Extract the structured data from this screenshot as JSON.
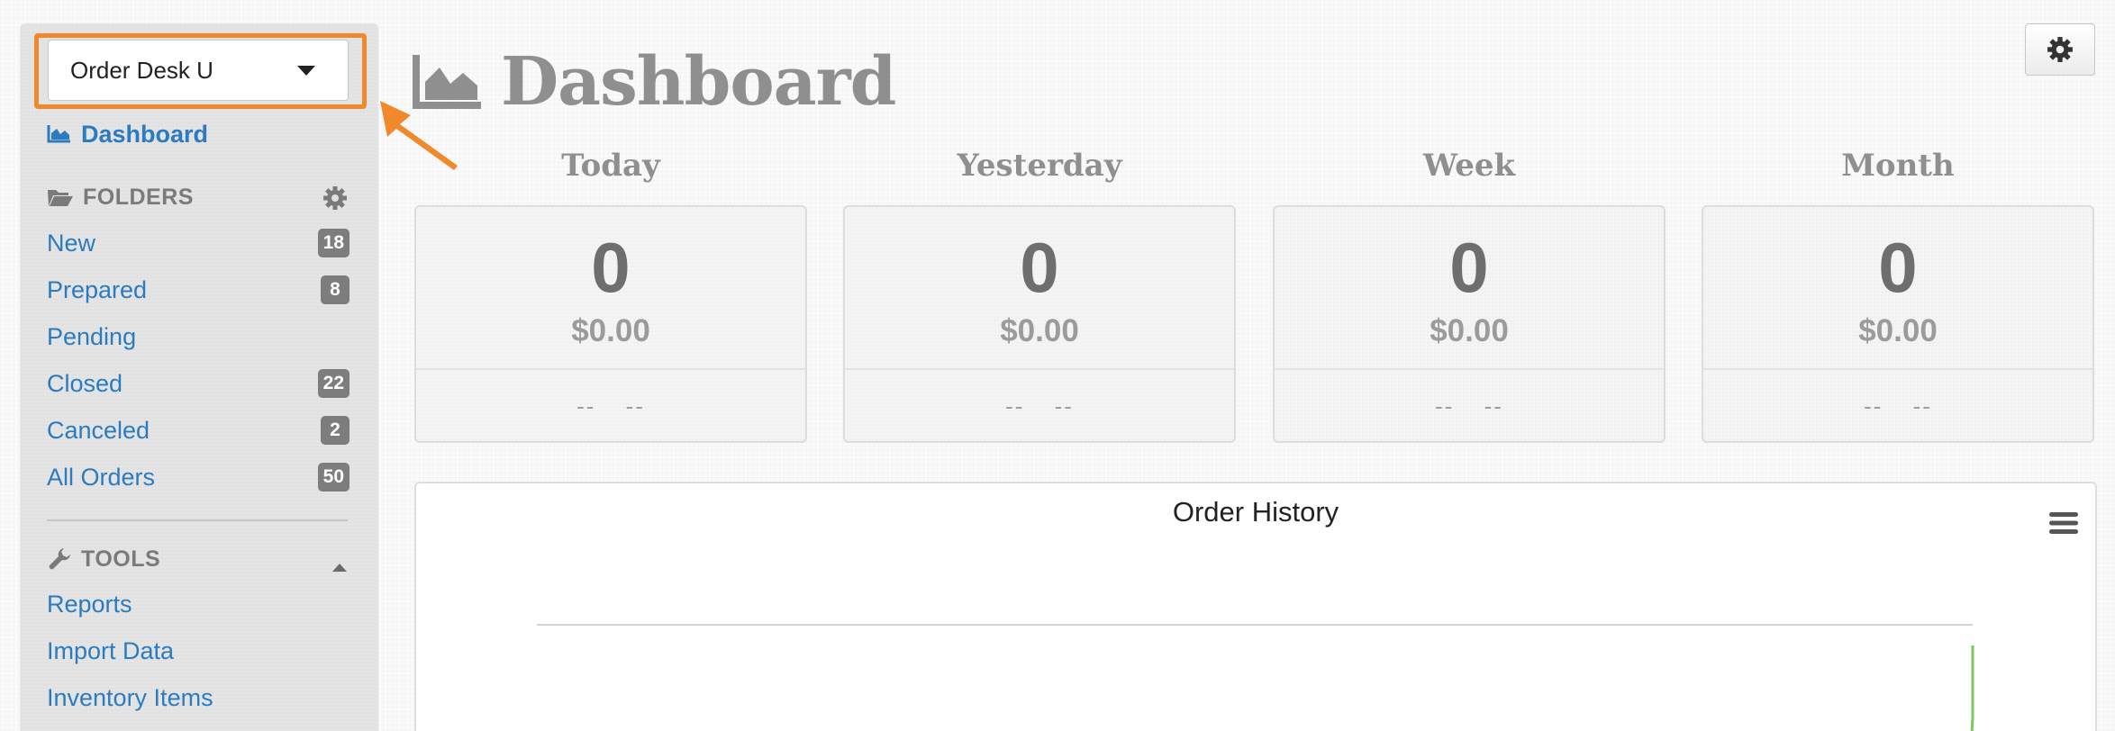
{
  "sidebar": {
    "store_selector": {
      "value": "Order Desk U"
    },
    "dashboard_link": "Dashboard",
    "folders": {
      "heading": "FOLDERS",
      "items": [
        {
          "label": "New",
          "count": "18"
        },
        {
          "label": "Prepared",
          "count": "8"
        },
        {
          "label": "Pending",
          "count": null
        },
        {
          "label": "Closed",
          "count": "22"
        },
        {
          "label": "Canceled",
          "count": "2"
        },
        {
          "label": "All Orders",
          "count": "50"
        }
      ]
    },
    "tools": {
      "heading": "TOOLS",
      "items": [
        {
          "label": "Reports"
        },
        {
          "label": "Import Data"
        },
        {
          "label": "Inventory Items"
        }
      ]
    }
  },
  "header": {
    "title": "Dashboard"
  },
  "stats": [
    {
      "label": "Today",
      "count": "0",
      "amount": "$0.00",
      "footer": "-- --"
    },
    {
      "label": "Yesterday",
      "count": "0",
      "amount": "$0.00",
      "footer": "-- --"
    },
    {
      "label": "Week",
      "count": "0",
      "amount": "$0.00",
      "footer": "-- --"
    },
    {
      "label": "Month",
      "count": "0",
      "amount": "$0.00",
      "footer": "-- --"
    }
  ],
  "chart": {
    "title": "Order History",
    "series_color": "#7cc85a"
  },
  "colors": {
    "accent_link": "#2a7bc0",
    "highlight": "#f0892b",
    "badge": "#7d7d7d"
  },
  "icons": [
    "area-chart-icon",
    "folder-open-icon",
    "gear-icon",
    "wrench-icon",
    "caret-up-icon",
    "caret-down-icon",
    "hamburger-menu-icon"
  ]
}
